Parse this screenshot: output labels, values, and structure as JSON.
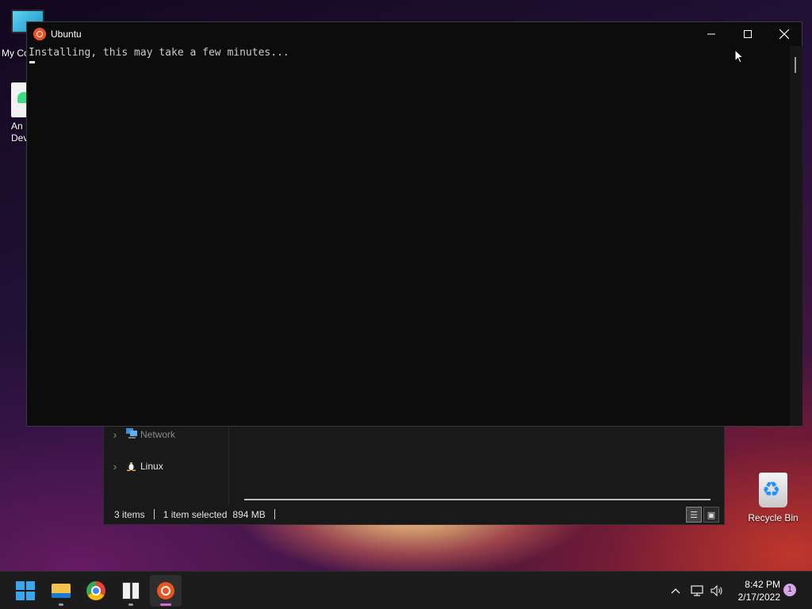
{
  "desktop": {
    "icons": [
      {
        "label": "My Co"
      },
      {
        "label_line1": "An",
        "label_line2": "Deve"
      },
      {
        "label": "Recycle Bin"
      }
    ]
  },
  "explorer": {
    "nav_items": [
      {
        "label": "Network",
        "icon": "network-icon"
      },
      {
        "label": "Linux",
        "icon": "penguin-icon"
      }
    ],
    "status": {
      "items": "3 items",
      "selected": "1 item selected",
      "size": "894 MB"
    }
  },
  "terminal": {
    "title": "Ubuntu",
    "output": "Installing, this may take a few minutes..."
  },
  "taskbar": {
    "apps": [
      {
        "name": "Start",
        "icon": "windows-logo-icon"
      },
      {
        "name": "File Explorer",
        "icon": "folder-icon"
      },
      {
        "name": "Google Chrome",
        "icon": "chrome-icon"
      },
      {
        "name": "Package",
        "icon": "package-icon"
      },
      {
        "name": "Ubuntu",
        "icon": "ubuntu-icon"
      }
    ],
    "clock": {
      "time": "8:42 PM",
      "date": "2/17/2022"
    },
    "notification_count": "1"
  },
  "colors": {
    "ubuntu_orange": "#e95420",
    "windows_blue": "#3aa6f0",
    "active_indicator": "#d46cd9"
  }
}
